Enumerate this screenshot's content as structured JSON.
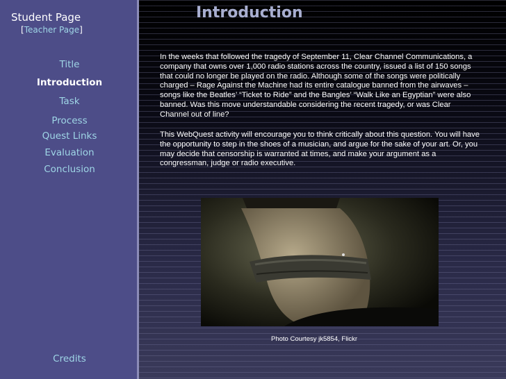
{
  "sidebar": {
    "brand": "Student Page",
    "teacher_open": "[",
    "teacher_link": "Teacher Page",
    "teacher_close": "]",
    "nav": [
      "Title",
      "Introduction",
      "Task",
      "Process",
      "Quest Links",
      "Evaluation",
      "Conclusion"
    ],
    "credits": "Credits"
  },
  "main": {
    "title": "Introduction",
    "paragraph1": "In the weeks that followed the tragedy of September 11, Clear Channel Communications, a company that owns over 1,000 radio stations across the country, issued a list of 150 songs that could no longer be played on the radio.  Although some of the songs were politically charged – Rage Against the Machine had its entire catalogue banned from the airwaves – songs like the Beatles’ “Ticket to Ride” and the Bangles’ “Walk Like an Egyptian” were also banned. Was this move understandable considering the recent tragedy, or was Clear Channel out of line?",
    "paragraph2": "This WebQuest activity will encourage you to think critically about this question. You will have the opportunity to step in the shoes of a musician, and argue for the sake of your art. Or, you may decide that censorship is warranted at times, and make your argument as a congressman, judge or radio executive.",
    "caption": "Photo Courtesy jk5854, Flickr"
  },
  "colors": {
    "sidebar_bg": "#4d4d88",
    "nav_link": "#9fd6e6",
    "title": "#a8aed0"
  }
}
